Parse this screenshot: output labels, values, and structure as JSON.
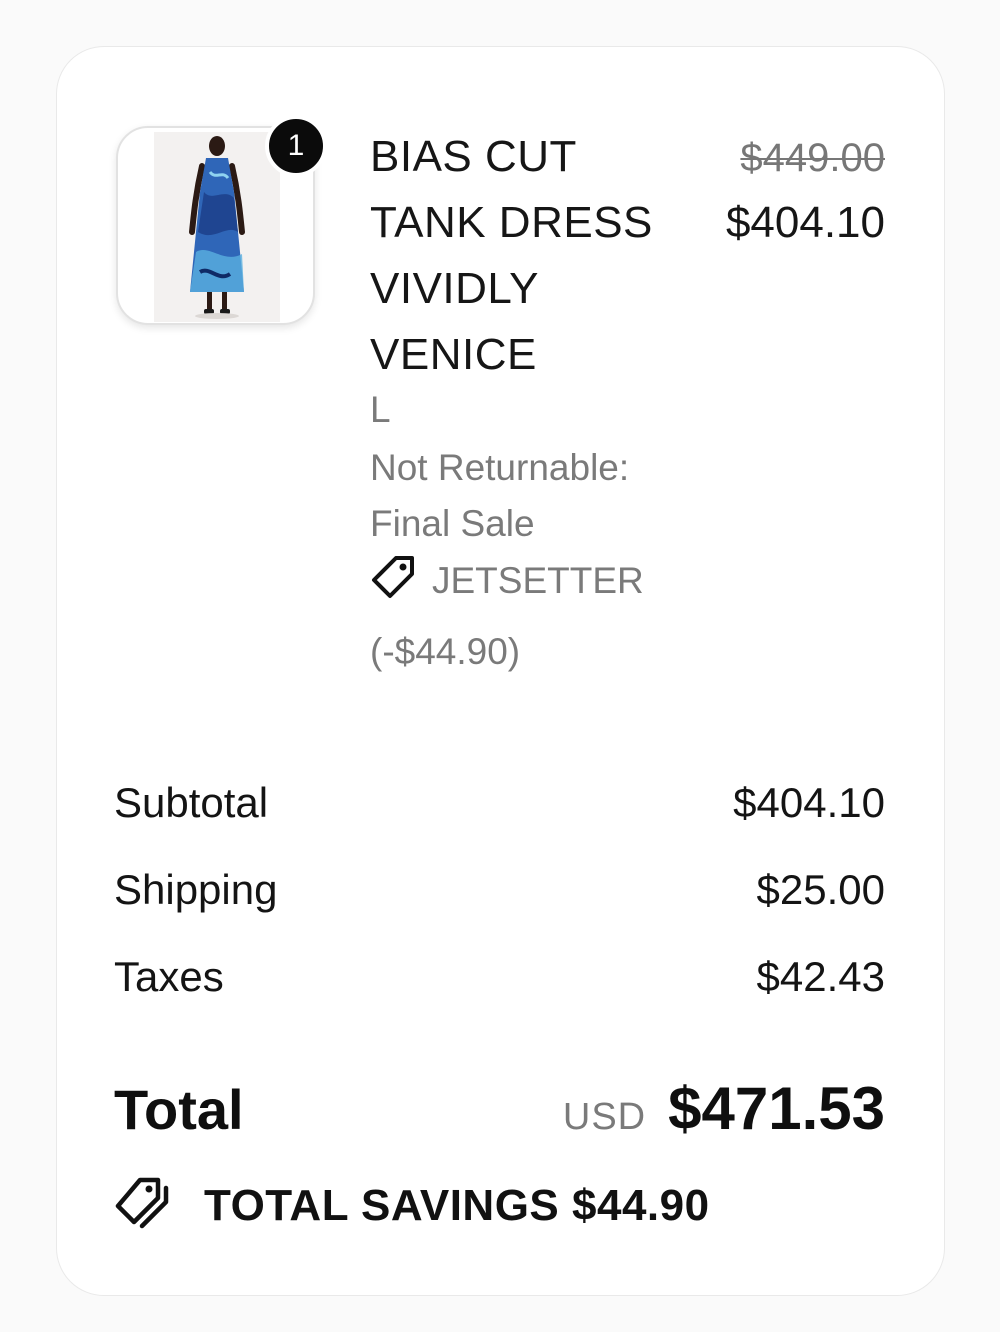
{
  "line_item": {
    "quantity": "1",
    "title_lines": [
      "BIAS CUT",
      "TANK DRESS",
      "VIVIDLY",
      "VENICE"
    ],
    "original_price": "$449.00",
    "sale_price": "$404.10",
    "size": "L",
    "return_policy_lines": [
      "Not Returnable:",
      "Final Sale"
    ],
    "discount_icon": "tag-icon",
    "discount_code": "JETSETTER",
    "discount_amount": "(-$44.90)",
    "image_alt": "Bias cut tank dress in blue Vividly Venice print"
  },
  "summary": {
    "subtotal_label": "Subtotal",
    "subtotal_value": "$404.10",
    "shipping_label": "Shipping",
    "shipping_value": "$25.00",
    "taxes_label": "Taxes",
    "taxes_value": "$42.43",
    "total_label": "Total",
    "currency": "USD",
    "total_value": "$471.53",
    "savings_icon": "tags-icon",
    "savings_text": "TOTAL SAVINGS $44.90"
  },
  "colors": {
    "text_primary": "#111111",
    "text_secondary": "#7a7a7a",
    "badge_bg": "#0b0b0b",
    "card_bg": "#ffffff",
    "page_bg": "#fafafa"
  }
}
